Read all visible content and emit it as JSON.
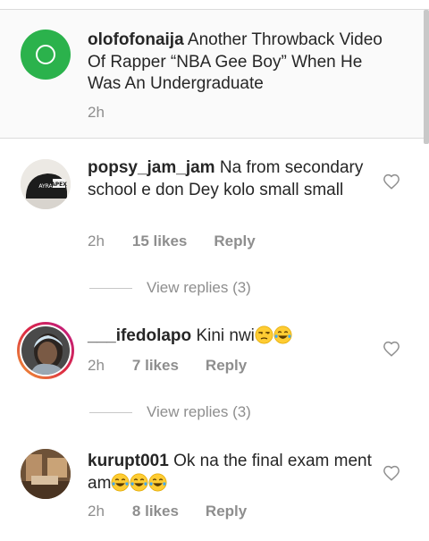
{
  "caption": {
    "username": "olofofonaija",
    "text": "Another Throwback Video Of Rapper “NBA Gee Boy” When He Was An Undergraduate",
    "time": "2h"
  },
  "comments": [
    {
      "username": "popsy_jam_jam",
      "text": "Na from secondary school e don Dey kolo small small",
      "time": "2h",
      "likes": "15 likes",
      "reply": "Reply",
      "view_replies": "View replies (3)",
      "avatar_text": "APEX"
    },
    {
      "username": "___ifedolapo",
      "text": "Kini nwi",
      "emojis": [
        "unamused-face",
        "tears-of-joy"
      ],
      "time": "2h",
      "likes": "7 likes",
      "reply": "Reply",
      "view_replies": "View replies (3)"
    },
    {
      "username": "kurupt001",
      "text": "Ok na the final exam ment am",
      "emojis": [
        "tears-of-joy",
        "tears-of-joy",
        "tears-of-joy"
      ],
      "time": "2h",
      "likes": "8 likes",
      "reply": "Reply"
    }
  ],
  "colors": {
    "caption_bg": "#fafafa",
    "avatar_green": "#2bb24c",
    "story_ring": "#d6249f",
    "muted_text": "#8e8e8e"
  }
}
